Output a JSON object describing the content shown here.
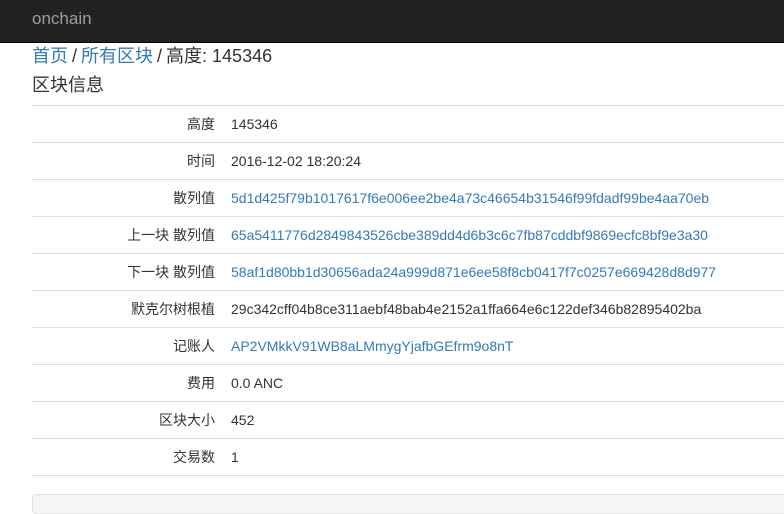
{
  "navbar": {
    "brand": "onchain"
  },
  "breadcrumb": {
    "home": "首页",
    "all_blocks": "所有区块",
    "current_label": "高度: 145346",
    "separator": "/"
  },
  "section_title": "区块信息",
  "rows": {
    "height": {
      "label": "高度",
      "value": "145346"
    },
    "time": {
      "label": "时间",
      "value": "2016-12-02 18:20:24"
    },
    "hash": {
      "label": "散列值",
      "value": "5d1d425f79b1017617f6e006ee2be4a73c46654b31546f99fdadf99be4aa70eb"
    },
    "prev_hash": {
      "label": "上一块 散列值",
      "value": "65a5411776d2849843526cbe389dd4d6b3c6c7fb87cddbf9869ecfc8bf9e3a30"
    },
    "next_hash": {
      "label": "下一块 散列值",
      "value": "58af1d80bb1d30656ada24a999d871e6ee58f8cb0417f7c0257e669428d8d977"
    },
    "merkle_root": {
      "label": "默克尔树根植",
      "value": "29c342cff04b8ce311aebf48bab4e2152a1ffa664e6c122def346b82895402ba"
    },
    "bookkeeper": {
      "label": "记账人",
      "value": "AP2VMkkV91WB8aLMmygYjafbGEfrm9o8nT"
    },
    "fee": {
      "label": "费用",
      "value": "0.0 ANC"
    },
    "size": {
      "label": "区块大小",
      "value": "452"
    },
    "tx_count": {
      "label": "交易数",
      "value": "1"
    }
  }
}
